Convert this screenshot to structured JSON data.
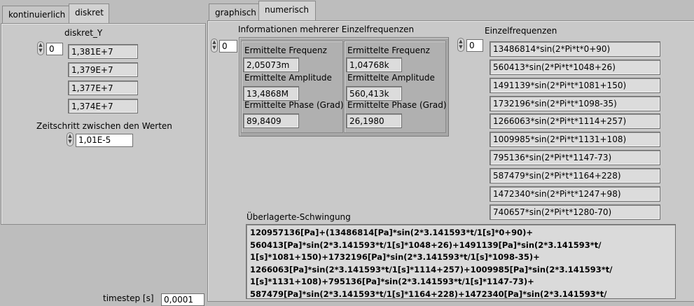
{
  "left_tabs": {
    "tab1": "kontinuierlich",
    "tab2": "diskret"
  },
  "right_tabs": {
    "tab1": "graphisch",
    "tab2": "numerisch"
  },
  "diskret": {
    "array_label": "diskret_Y",
    "index": "0",
    "values": [
      "1,381E+7",
      "1,379E+7",
      "1,377E+7",
      "1,374E+7"
    ],
    "step_label": "Zeitschritt zwischen den Werten",
    "step_value": "1,01E-5"
  },
  "timestep": {
    "label": "timestep [s]",
    "value": "0,0001"
  },
  "info": {
    "label": "Informationen mehrerer Einzelfrequenzen",
    "index": "0",
    "clusters": [
      {
        "freq_label": "Ermittelte Frequenz",
        "freq_value": "2,05073m",
        "amp_label": "Ermittelte Amplitude",
        "amp_value": "13,4868M",
        "phase_label": "Ermittelte Phase (Grad)",
        "phase_value": "89,8409"
      },
      {
        "freq_label": "Ermittelte Frequenz",
        "freq_value": "1,04768k",
        "amp_label": "Ermittelte Amplitude",
        "amp_value": "560,413k",
        "phase_label": "Ermittelte Phase (Grad)",
        "phase_value": "26,1980"
      }
    ]
  },
  "einzel": {
    "label": "Einzelfrequenzen",
    "index": "0",
    "items": [
      "13486814*sin(2*Pi*t*0+90)",
      "560413*sin(2*Pi*t*1048+26)",
      "1491139*sin(2*Pi*t*1081+150)",
      "1732196*sin(2*Pi*t*1098-35)",
      "1266063*sin(2*Pi*t*1114+257)",
      "1009985*sin(2*Pi*t*1131+108)",
      "795136*sin(2*Pi*t*1147-73)",
      "587479*sin(2*Pi*t*1164+228)",
      "1472340*sin(2*Pi*t*1247+98)",
      "740657*sin(2*Pi*t*1280-70)"
    ]
  },
  "overlay": {
    "label": "Überlagerte-Schwingung",
    "text": "120957136[Pa]+(13486814[Pa]*sin(2*3.141593*t/1[s]*0+90)+\n560413[Pa]*sin(2*3.141593*t/1[s]*1048+26)+1491139[Pa]*sin(2*3.141593*t/\n1[s]*1081+150)+1732196[Pa]*sin(2*3.141593*t/1[s]*1098-35)+\n1266063[Pa]*sin(2*3.141593*t/1[s]*1114+257)+1009985[Pa]*sin(2*3.141593*t/\n1[s]*1131+108)+795136[Pa]*sin(2*3.141593*t/1[s]*1147-73)+\n587479[Pa]*sin(2*3.141593*t/1[s]*1164+228)+1472340[Pa]*sin(2*3.141593*t/"
  }
}
